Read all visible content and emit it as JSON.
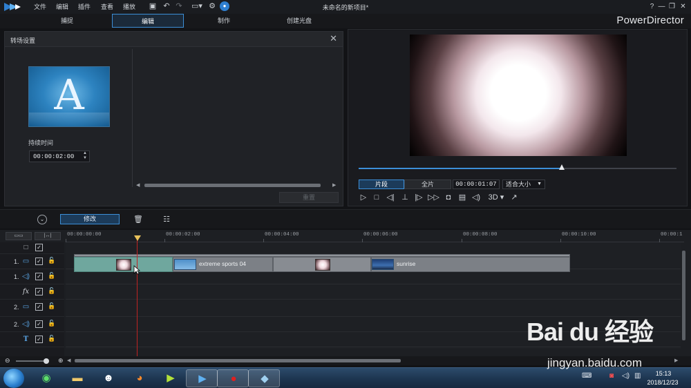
{
  "menu": {
    "items": [
      "文件",
      "编辑",
      "插件",
      "查看",
      "播放"
    ]
  },
  "window": {
    "title": "未命名的新项目*",
    "controls": [
      "?",
      "—",
      "❐",
      "✕"
    ]
  },
  "tabs": [
    {
      "label": "捕捉",
      "active": false
    },
    {
      "label": "编辑",
      "active": true
    },
    {
      "label": "制作",
      "active": false
    },
    {
      "label": "创建光盘",
      "active": false
    }
  ],
  "brand": "PowerDirector",
  "transition_panel": {
    "title": "转场设置",
    "thumbnail_letter": "A",
    "duration_label": "持续时间",
    "duration_value": "00:00:02:00",
    "reset_label": "重置"
  },
  "preview": {
    "mode_clip": "片段",
    "mode_full": "全片",
    "timecode": "00:00:01:07",
    "fit_label": "适合大小",
    "scrub_progress": 0.64,
    "controls": [
      "play-icon",
      "stop-icon",
      "prev-frame-icon",
      "marker-icon",
      "next-frame-icon",
      "fast-forward-icon",
      "snapshot-icon",
      "subtitle-icon",
      "volume-icon",
      "3d-icon",
      "undock-icon"
    ],
    "threed_label": "3D"
  },
  "edit_toolbar": {
    "modify_label": "修改"
  },
  "timeline": {
    "ruler_labels": [
      "00:00:00:00",
      "00:00:02:00",
      "00:00:04:00",
      "00:00:06:00",
      "00:00:08:00",
      "00:00:10:00",
      "00:00:1"
    ],
    "tracks": [
      {
        "num": "1.",
        "type": "video"
      },
      {
        "num": "1.",
        "type": "audio"
      },
      {
        "num": "",
        "type": "fx"
      },
      {
        "num": "2.",
        "type": "video"
      },
      {
        "num": "2.",
        "type": "audio"
      },
      {
        "num": "",
        "type": "title"
      }
    ],
    "clips": [
      {
        "label": "extreme sports 04"
      },
      {
        "label": "sunrise"
      }
    ]
  },
  "taskbar": {
    "time": "15:13",
    "date": "2018/12/23"
  },
  "watermark": {
    "logo": "Bai du 经验",
    "url": "jingyan.baidu.com"
  }
}
